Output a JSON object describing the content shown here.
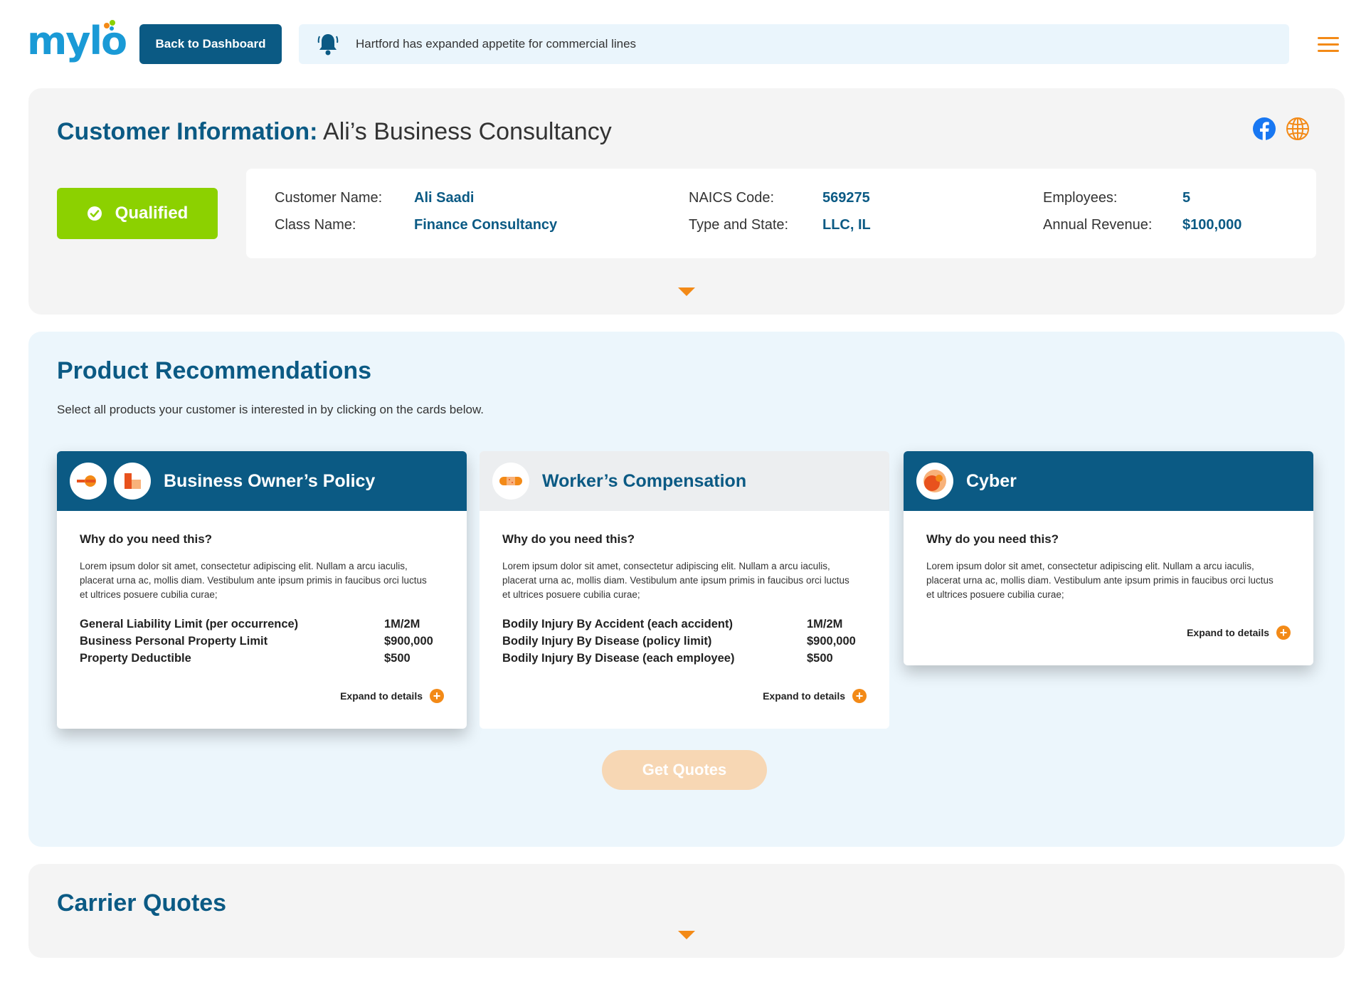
{
  "header": {
    "logo_text": "mylo",
    "back_label": "Back to Dashboard",
    "notice_text": "Hartford has expanded appetite for commercial lines",
    "bell_icon": "bell-icon",
    "menu_icon": "hamburger-menu-icon"
  },
  "customer": {
    "title_label": "Customer Information:",
    "title_value": "Ali’s Business Consultancy",
    "social_icons": [
      "facebook-icon",
      "globe-icon"
    ],
    "status": "Qualified",
    "fields": {
      "customer_name_label": "Customer Name:",
      "customer_name": "Ali Saadi",
      "class_name_label": "Class Name:",
      "class_name": "Finance Consultancy",
      "naics_label": "NAICS Code:",
      "naics": "569275",
      "type_state_label": "Type and State:",
      "type_state": "LLC, IL",
      "employees_label": "Employees:",
      "employees": "5",
      "revenue_label": "Annual Revenue:",
      "revenue": "$100,000"
    }
  },
  "products": {
    "title": "Product Recommendations",
    "subtitle": "Select all products your customer is interested in by clicking on the cards below.",
    "cards": [
      {
        "title": "Business Owner’s Policy",
        "selected": true,
        "why": "Why do you need this?",
        "description": "Lorem ipsum dolor sit amet, consectetur adipiscing elit. Nullam a arcu iaculis, placerat urna ac, mollis diam. Vestibulum ante ipsum primis in faucibus orci luctus et ultrices posuere cubilia curae;",
        "limits": [
          {
            "label": "General Liability Limit (per occurrence)",
            "value": "1M/2M"
          },
          {
            "label": "Business Personal Property Limit",
            "value": "$900,000"
          },
          {
            "label": "Property Deductible",
            "value": "$500"
          }
        ],
        "expand_label": "Expand to details"
      },
      {
        "title": "Worker’s Compensation",
        "selected": false,
        "why": "Why do you need this?",
        "description": "Lorem ipsum dolor sit amet, consectetur adipiscing elit. Nullam a arcu iaculis, placerat urna ac, mollis diam. Vestibulum ante ipsum primis in faucibus orci luctus et ultrices posuere cubilia curae;",
        "limits": [
          {
            "label": "Bodily Injury By Accident (each accident)",
            "value": "1M/2M"
          },
          {
            "label": "Bodily Injury By Disease (policy limit)",
            "value": "$900,000"
          },
          {
            "label": "Bodily Injury By Disease (each employee)",
            "value": "$500"
          }
        ],
        "expand_label": "Expand to details"
      },
      {
        "title": "Cyber",
        "selected": true,
        "why": "Why do you need this?",
        "description": "Lorem ipsum dolor sit amet, consectetur adipiscing elit. Nullam a arcu iaculis, placerat urna ac, mollis diam. Vestibulum ante ipsum primis in faucibus orci luctus et ultrices posuere cubilia curae;",
        "limits": [],
        "expand_label": "Expand to details"
      }
    ],
    "get_quotes_label": "Get Quotes"
  },
  "carrier": {
    "title": "Carrier Quotes"
  },
  "colors": {
    "brand_blue": "#0b5a84",
    "accent_orange": "#f38a17",
    "qualified_green": "#8cd100"
  }
}
